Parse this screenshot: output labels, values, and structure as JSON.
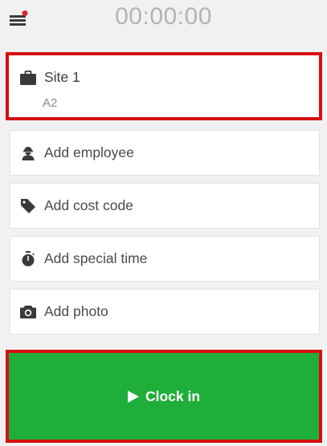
{
  "header": {
    "timer": "00:00:00",
    "menu_icon": "menu-icon",
    "notification_color": "#d8262d"
  },
  "site": {
    "name": "Site 1",
    "subtitle": "A2",
    "icon": "briefcase-icon"
  },
  "actions": [
    {
      "label": "Add employee",
      "icon": "worker-icon"
    },
    {
      "label": "Add cost code",
      "icon": "tag-icon"
    },
    {
      "label": "Add special time",
      "icon": "stopwatch-icon"
    },
    {
      "label": "Add photo",
      "icon": "camera-icon"
    }
  ],
  "clock": {
    "label": "Clock in",
    "icon": "play-icon",
    "color": "#1fae3a"
  },
  "highlight_color": "#d60f0f"
}
